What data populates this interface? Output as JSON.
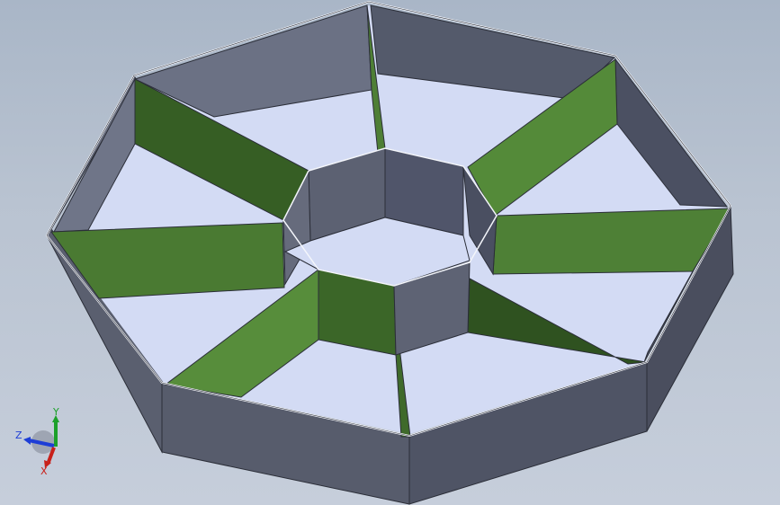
{
  "viewport": {
    "colors": {
      "background_top": "#a9b6c7",
      "background_bottom": "#c6cedb",
      "tray_wall": "#5e6373",
      "tray_wall_dark": "#4c5060",
      "tray_floor": "#d3dbf4",
      "divider_green": "#4e7f35",
      "divider_green_dark": "#365e24",
      "edge": "#2b2e38",
      "edge_highlight": "#ffffff"
    }
  },
  "triad": {
    "x_label": "X",
    "y_label": "Y",
    "z_label": "Z",
    "colors": {
      "x": "#c8201a",
      "y": "#1ca02a",
      "z": "#1e3ed6"
    }
  }
}
